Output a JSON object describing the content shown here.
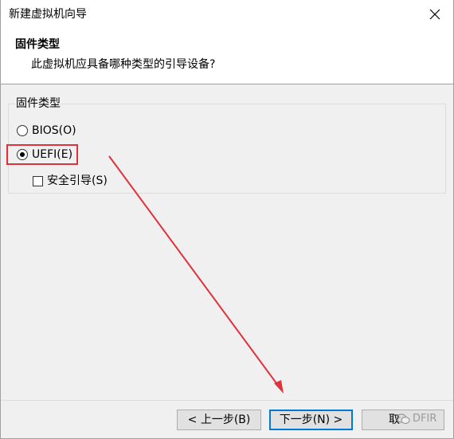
{
  "window": {
    "title": "新建虚拟机向导"
  },
  "header": {
    "title": "固件类型",
    "subtitle": "此虚拟机应具备哪种类型的引导设备?"
  },
  "firmware_group": {
    "legend": "固件类型",
    "options": [
      {
        "label": "BIOS(O)",
        "checked": false
      },
      {
        "label": "UEFI(E)",
        "checked": true
      }
    ],
    "secure_boot": {
      "label": "安全引导(S)",
      "checked": false
    }
  },
  "buttons": {
    "back": "< 上一步(B)",
    "next": "下一步(N) >",
    "cancel": "取"
  },
  "watermark": {
    "text": "DFIR"
  },
  "annotation": {
    "highlight_color": "#e0323c",
    "arrow_color": "#e0323c"
  },
  "colors": {
    "accent": "#0078d7"
  }
}
